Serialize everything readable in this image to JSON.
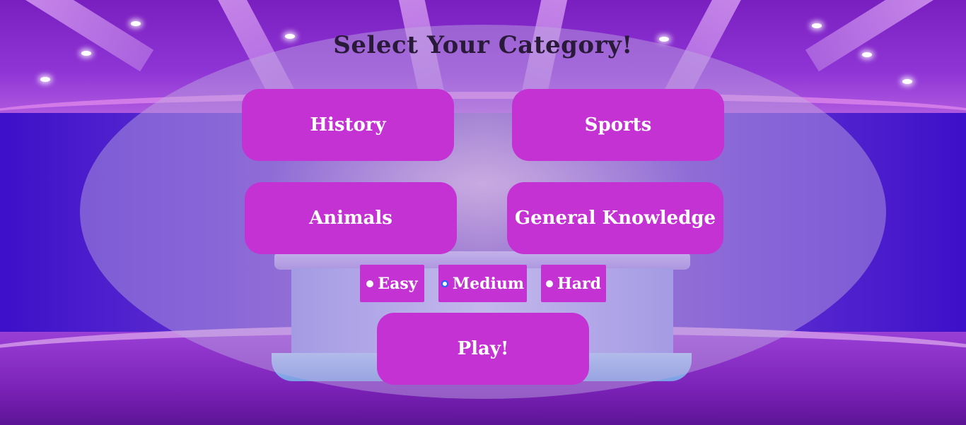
{
  "page": {
    "title": "Select Your Category!"
  },
  "categories": [
    {
      "label": "History"
    },
    {
      "label": "Sports"
    },
    {
      "label": "Animals"
    },
    {
      "label": "General Knowledge"
    }
  ],
  "difficulty": {
    "options": [
      {
        "label": "Easy",
        "checked": false
      },
      {
        "label": "Medium",
        "checked": true
      },
      {
        "label": "Hard",
        "checked": false
      }
    ]
  },
  "play": {
    "label": "Play!"
  },
  "colors": {
    "button_bg": "#c532d4",
    "button_text": "#ffffff",
    "title_text": "#2a1a3a",
    "radio_checked_ring": "#1565ff"
  }
}
